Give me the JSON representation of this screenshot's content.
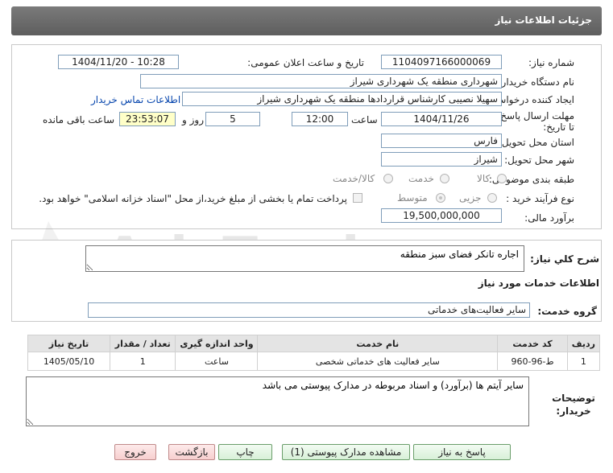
{
  "header": {
    "title": "جزئیات اطلاعات نیاز"
  },
  "need": {
    "number_label": "شماره نیاز:",
    "number": "1104097166000069",
    "announce_label": "تاریخ و ساعت اعلان عمومی:",
    "announce": "1404/11/20 - 10:28",
    "buyer_label": "نام دستگاه خریدار:",
    "buyer": "شهرداری منطقه یک شهرداری شیراز",
    "creator_label": "ایجاد کننده درخواست:",
    "creator": "سهیلا نصیبی کارشناس قراردادها منطقه یک شهرداری شیراز",
    "contact_link": "اطلاعات تماس خریدار",
    "deadline_label": "مهلت ارسال پاسخ: تا تاریخ:",
    "deadline_date": "1404/11/26",
    "time_label": "ساعت",
    "deadline_time": "12:00",
    "days": "5",
    "days_label": "روز و",
    "remaining": "23:53:07",
    "remaining_label": "ساعت باقی مانده",
    "province_label": "استان محل تحویل:",
    "province": "فارس",
    "city_label": "شهر محل تحویل:",
    "city": "شیراز",
    "category_label": "طبقه بندی موضوعی:",
    "category_options": [
      "کالا",
      "خدمت",
      "کالا/خدمت"
    ],
    "process_label": "نوع فرآیند خرید :",
    "process_options": [
      "جزیی",
      "متوسط"
    ],
    "payment_note": "پرداخت تمام یا بخشی از مبلغ خرید،از محل \"اسناد خزانه اسلامی\" خواهد بود.",
    "estimate_label": "برآورد مالی:",
    "estimate": "19,500,000,000"
  },
  "description": {
    "label": "شرح کلي نياز:",
    "text": "اجاره تانکر فضای سبز منطقه"
  },
  "services": {
    "title": "اطلاعات خدمات مورد نياز",
    "group_label": "گروه خدمت:",
    "group": "سایر فعالیت‌های خدماتی",
    "columns": [
      "ردیف",
      "کد خدمت",
      "نام خدمت",
      "واحد اندازه گیری",
      "تعداد / مقدار",
      "تاریخ نیاز"
    ],
    "rows": [
      [
        "1",
        "ط-96-960",
        "سایر فعالیت های خدماتی شخصی",
        "ساعت",
        "1",
        "1405/05/10"
      ]
    ]
  },
  "notes": {
    "label": "توضيحات خريدار:",
    "text": "سایر آیتم ها (برآورد) و اسناد مربوطه در مدارک پیوستی می باشد"
  },
  "buttons": {
    "reply": "پاسخ به نیاز",
    "attachments": "مشاهده مدارک پیوستی (1)",
    "print": "چاپ",
    "back": "بازگشت",
    "exit": "خروج"
  },
  "watermark": {
    "text": "AriaTender.neT"
  }
}
